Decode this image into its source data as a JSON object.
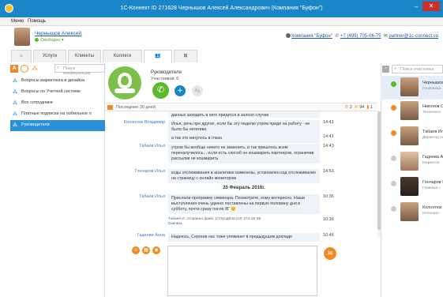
{
  "window": {
    "title": "1С-Коннект ID 271628 Чернышов Алексей Александрович (Компания \"Буфон\")",
    "minimize": "–",
    "maximize": "□",
    "close": "✕"
  },
  "menu": [
    "Меню",
    "Помощь"
  ],
  "user": {
    "name": "Чернышов Алексей",
    "status": "Свободен ▾",
    "company": "Компания \"Буфон\"",
    "phone": "+7 (499) 705-06-75",
    "email": "partner@1c-connect.co"
  },
  "tabs": [
    {
      "label": "⌂",
      "icon": "home-icon"
    },
    {
      "label": "Услуги"
    },
    {
      "label": "Клиенты"
    },
    {
      "label": "Коллеги"
    },
    {
      "label": "👥",
      "icon": "group-icon"
    },
    {
      "label": "⊞",
      "icon": "grid-icon"
    }
  ],
  "left": {
    "tool_a": "A",
    "search_placeholder": "Поиск конференции",
    "conversations": [
      "Вопросы маркетинга и дизайна",
      "Вопросы по Учетной системе",
      "Все сотрудники",
      "Платные подписки на побильное п",
      "Руководители"
    ],
    "active_index": 4
  },
  "room": {
    "title": "Руководители",
    "members": "Участников: 6"
  },
  "period": {
    "label": "Последние 30 дней",
    "calls": "2",
    "messages": "94",
    "files": "1"
  },
  "messages": [
    {
      "author": "",
      "text": "данных заходить в него придется в залсоп случае",
      "time": ""
    },
    {
      "author": "Колонтюк Владимир",
      "text": "Илья, речь про других, если бы эту неделю утром придя на работу - не было бы негатива",
      "time": "14:41"
    },
    {
      "author": "",
      "text": "а так это кинулось в глаза",
      "time": "14:41"
    },
    {
      "author": "Табаев Илья",
      "text": "утром бы вообще ничего не заменить, а так пришлось всем переналучилось... если есть способ не кошмарить партнеров, ограничив рассылки не кошмарить",
      "time": "14:43"
    },
    {
      "author": "Гончаров Илья",
      "text": "коды отслеживания в аналитике изменены, установлен код отслеживания на страницу с онлайн монитором",
      "time": "14:53"
    },
    {
      "author": "Табаев Илья",
      "text": "Прислали программу семинара. Посмотрите, кому интересно. Наши выступления очень удачно поставлены на первую половину дня в субботу, почти сразу после 8Г 😊",
      "time": "10:36"
    },
    {
      "author": "Гадеева Анна",
      "text": "Надеюсь, Сергеев нас тоже упомянет в предыдущем докладе",
      "time": "10:46"
    }
  ],
  "date_separator": "20 Февраль 2016г.",
  "file_note": {
    "text": "Табаев И. отправил файл 1СПродВ16.pdf, 274.28 КБ",
    "link": "Скачать",
    "time": "10:36"
  },
  "right": {
    "collapse": "‹",
    "search_placeholder": "Поиск участника",
    "members": [
      {
        "name": "Чернышов",
        "role": "Генеральн",
        "status": "green"
      },
      {
        "name": "Никонов Се",
        "role": "Техническ",
        "status": "orange"
      },
      {
        "name": "Табаев Илья",
        "role": "Директор по",
        "status": "orange"
      },
      {
        "name": "Гадеева Ан",
        "role": "Маркетол",
        "status": "grey"
      },
      {
        "name": "Гончаров И",
        "role": "Главный с",
        "status": "grey"
      },
      {
        "name": "Колонтюк",
        "role": "Исполнит",
        "status": "grey"
      }
    ]
  },
  "colors": {
    "accent": "#1a86c8",
    "orange": "#f08a24",
    "green": "#5cb82c"
  }
}
